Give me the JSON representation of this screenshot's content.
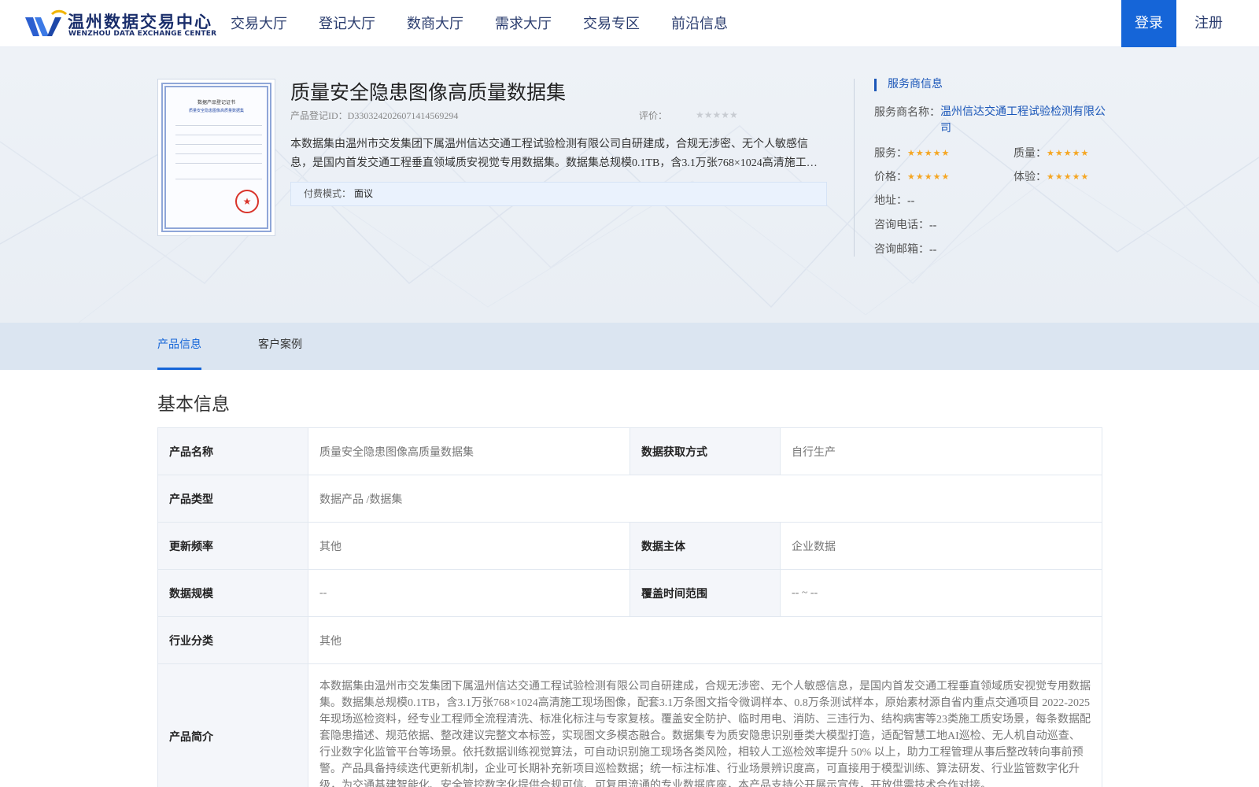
{
  "header": {
    "logo": {
      "cn": "温州数据交易中心",
      "en": "WENZHOU DATA EXCHANGE CENTER"
    },
    "nav": [
      "交易大厅",
      "登记大厅",
      "数商大厅",
      "需求大厅",
      "交易专区",
      "前沿信息"
    ],
    "login": "登录",
    "register": "注册"
  },
  "product": {
    "title": "质量安全隐患图像高质量数据集",
    "id_text": "产品登记ID：D3303242026071414569294",
    "rating_label": "评价：",
    "rating_stars": "★★★★★",
    "rating_value": 0,
    "description": "本数据集由温州市交发集团下属温州信达交通工程试验检测有限公司自研建成，合规无涉密、无个人敏感信息，是国内首发交通工程垂直领域质安视觉专用数据集。数据集总规模0.1TB，含3.1万张768×1024高清施工现场图像，配套3.1万条图文指令微调样本、0.8万条测试样本，原始素材源自省内重点交通项目 2022-2025年现场巡检资料，经专业工程师全流程清洗、标准化标注与专家复核。",
    "pay_label": "付费模式：",
    "pay_value": "面议",
    "certificate": {
      "title": "数据产品登记证书",
      "subtitle": "质量安全隐患图像高质量数据集",
      "seal": "★"
    }
  },
  "provider": {
    "heading": "服务商信息",
    "name_label": "服务商名称：",
    "name_value": "温州信达交通工程试验检测有限公司",
    "scores": [
      {
        "label": "服务：",
        "stars": "★★★★★",
        "value": 5
      },
      {
        "label": "质量：",
        "stars": "★★★★★",
        "value": 5
      },
      {
        "label": "价格：",
        "stars": "★★★★★",
        "value": 5
      },
      {
        "label": "体验：",
        "stars": "★★★★★",
        "value": 5
      }
    ],
    "address_label": "地址：",
    "address_value": "--",
    "phone_label": "咨询电话：",
    "phone_value": "--",
    "email_label": "咨询邮箱：",
    "email_value": "--"
  },
  "tabs": [
    {
      "label": "产品信息",
      "active": true
    },
    {
      "label": "客户案例",
      "active": false
    }
  ],
  "basic_info": {
    "title": "基本信息",
    "rows": [
      {
        "k1": "产品名称",
        "v1": "质量安全隐患图像高质量数据集",
        "k2": "数据获取方式",
        "v2": "自行生产"
      },
      {
        "k1": "产品类型",
        "v1": "数据产品 /数据集"
      },
      {
        "k1": "更新频率",
        "v1": "其他",
        "k2": "数据主体",
        "v2": "企业数据"
      },
      {
        "k1": "数据规模",
        "v1": "--",
        "k2": "覆盖时间范围",
        "v2": "-- ~ --"
      },
      {
        "k1": "行业分类",
        "v1": "其他"
      },
      {
        "k1": "产品简介",
        "v1": "本数据集由温州市交发集团下属温州信达交通工程试验检测有限公司自研建成，合规无涉密、无个人敏感信息，是国内首发交通工程垂直领域质安视觉专用数据集。数据集总规模0.1TB，含3.1万张768×1024高清施工现场图像，配套3.1万条图文指令微调样本、0.8万条测试样本，原始素材源自省内重点交通项目 2022-2025年现场巡检资料，经专业工程师全流程清洗、标准化标注与专家复核。覆盖安全防护、临时用电、消防、三违行为、结构病害等23类施工质安场景，每条数据配套隐患描述、规范依据、整改建议完整文本标签，实现图文多模态融合。数据集专为质安隐患识别垂类大模型打造，适配智慧工地AI巡检、无人机自动巡查、行业数字化监管平台等场景。依托数据训练视觉算法，可自动识别施工现场各类风险，相较人工巡检效率提升 50% 以上，助力工程管理从事后整改转向事前预警。产品具备持续迭代更新机制，企业可长期补充新项目巡检数据；统一标注标准、行业场景辨识度高，可直接用于模型训练、算法研发、行业监管数字化升级，为交通基建智能化、安全管控数字化提供合规可信、可复用流通的专业数据底座，本产品支持公开展示宣传，开放供需技术合作对接。"
      }
    ]
  },
  "colors": {
    "brand": "#1565d8",
    "nav_text": "#2a3c6e",
    "star_active": "#f5a623",
    "star_inactive": "#c8ccd2",
    "tab_bar": "#dbe5f1"
  },
  "icons": [
    "logo-mark-icon",
    "star-icon",
    "seal-icon"
  ]
}
